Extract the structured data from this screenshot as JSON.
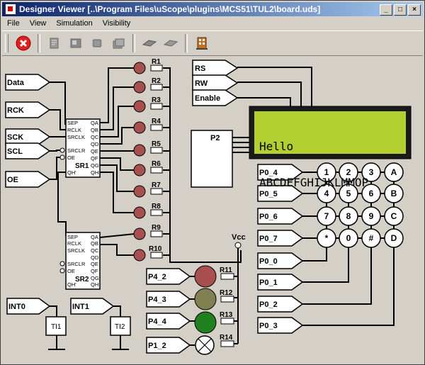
{
  "window": {
    "title": "Designer Viewer [..\\Program Files\\uScope\\plugins\\MCS51\\TUL2\\board.uds]",
    "controls": [
      "_",
      "□",
      "×"
    ]
  },
  "menu": [
    "File",
    "View",
    "Simulation",
    "Visibility"
  ],
  "toolbar": {
    "icons": [
      "stop-icon",
      "page-icon",
      "block-icon",
      "chip-icon",
      "stack-icon",
      "chip-dark-icon",
      "chip-dark-icon-2",
      "building-icon"
    ]
  },
  "inputs_left": {
    "data": "Data",
    "rck": "RCK",
    "sck": "SCK",
    "scl": "SCL",
    "oe": "OE"
  },
  "sr1": {
    "label": "SR1",
    "pins_left": [
      "SEP",
      "RCLK",
      "SRCLK",
      "SRCLR",
      "OE"
    ],
    "pins_right": [
      "QA",
      "QB",
      "QC",
      "QD",
      "QE",
      "QF",
      "QG",
      "QH"
    ],
    "qh_prime": "QH'"
  },
  "sr2": {
    "label": "SR2",
    "pins_left": [
      "SEP",
      "RCLK",
      "SRCLK",
      "SRCLR",
      "OE"
    ],
    "pins_right": [
      "QA",
      "QB",
      "QC",
      "QD",
      "QE",
      "QF",
      "QG",
      "QH"
    ],
    "qh_prime": "QH'"
  },
  "resistors": [
    "R1",
    "R2",
    "R3",
    "R4",
    "R5",
    "R6",
    "R7",
    "R8",
    "R9",
    "R10"
  ],
  "lcd_inputs": [
    "RS",
    "RW",
    "Enable"
  ],
  "lcd": {
    "line1": "Hello",
    "line2": "ABCDEFGHIJKLMMOP",
    "bg": "#b4d030"
  },
  "p2_label": "P2",
  "vcc_label": "Vcc",
  "keypad": {
    "rows": [
      {
        "label": "P0_4",
        "keys": [
          "1",
          "2",
          "3",
          "A"
        ]
      },
      {
        "label": "P0_5",
        "keys": [
          "4",
          "5",
          "6",
          "B"
        ]
      },
      {
        "label": "P0_6",
        "keys": [
          "7",
          "8",
          "9",
          "C"
        ]
      },
      {
        "label": "P0_7",
        "keys": [
          "*",
          "0",
          "#",
          "D"
        ]
      }
    ],
    "cols": [
      "P0_0",
      "P0_1",
      "P0_2",
      "P0_3"
    ]
  },
  "lamps": [
    {
      "label": "P4_2",
      "resistor": "R11",
      "color": "#a85050"
    },
    {
      "label": "P4_3",
      "resistor": "R12",
      "color": "#808050"
    },
    {
      "label": "P4_4",
      "resistor": "R13",
      "color": "#208020"
    },
    {
      "label": "P1_2",
      "resistor": "R14",
      "color": "#ffffff"
    }
  ],
  "interrupts": [
    {
      "label": "INT0",
      "button": "TI1"
    },
    {
      "label": "INT1",
      "button": "TI2"
    }
  ]
}
